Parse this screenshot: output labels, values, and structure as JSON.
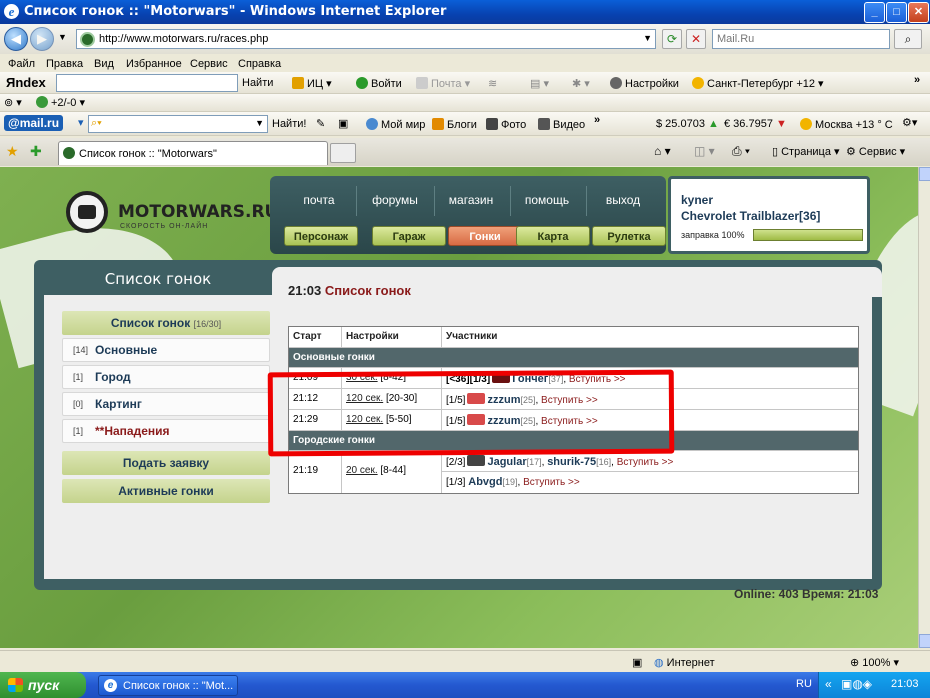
{
  "window": {
    "title": "Список гонок :: \"Motorwars\" - Windows Internet Explorer",
    "min": "_",
    "max": "□",
    "close": "✕"
  },
  "browser": {
    "address": "http://www.motorwars.ru/races.php",
    "search_placeholder": "Mail.Ru",
    "menu": [
      "Файл",
      "Правка",
      "Вид",
      "Избранное",
      "Сервис",
      "Справка"
    ],
    "yandex": {
      "brand": "Яndex",
      "find": "Найти",
      "ic": "ИЦ",
      "login": "Войти",
      "mail": "Почта",
      "settings": "Настройки",
      "weather": "Санкт-Петербург +12",
      "counter": "+2/-0"
    },
    "mailru": {
      "brand": "@mail.ru",
      "find": "Найти!",
      "myworld": "Мой мир",
      "blogs": "Блоги",
      "photo": "Фото",
      "video": "Видео",
      "usd": "$ 25.0703",
      "eur": "€ 36.7957",
      "weather": "Москва +13 ° С"
    },
    "tab": "Список гонок :: \"Motorwars\"",
    "tab_tools": {
      "page": "Страница",
      "service": "Сервис"
    },
    "status": {
      "zone": "Интернет",
      "zoom": "100%"
    }
  },
  "site": {
    "logo": {
      "name": "MOTORWARS.RU",
      "sub": "СКОРОСТЬ ОН-ЛАЙН"
    },
    "topnav": [
      "почта",
      "форумы",
      "магазин",
      "помощь",
      "выход"
    ],
    "subnav": [
      "Персонаж",
      "Гараж",
      "Гонки",
      "Карта",
      "Рулетка"
    ],
    "active_subnav": "Гонки",
    "user": {
      "name": "kyner",
      "car": "Chevrolet Trailblazer[36]",
      "fuel_label": "заправка 100%",
      "fuel_percent": 100
    },
    "left_title": "Список гонок",
    "left_menu": [
      {
        "label": "Список гонок",
        "suffix": "[16/30]"
      },
      {
        "count": "[14]",
        "label": "Основные"
      },
      {
        "count": "[1]",
        "label": "Город"
      },
      {
        "count": "[0]",
        "label": "Картинг"
      },
      {
        "count": "[1]",
        "label": "**Нападения"
      },
      {
        "label": "Подать заявку"
      },
      {
        "label": "Активные гонки"
      }
    ],
    "content_time": "21:03",
    "content_title": "Список гонок",
    "table": {
      "headers": [
        "Старт",
        "Настройки",
        "Участники"
      ],
      "sections": [
        "Основные гонки",
        "Городские гонки"
      ],
      "main_races": [
        {
          "start": "21:09",
          "interval": "30 сек.",
          "range": "[8-42]",
          "slots": "[<36][1/3]",
          "nick": "Гончег",
          "level": "[37]",
          "join": "Вступить >>"
        },
        {
          "start": "21:12",
          "interval": "120 сек.",
          "range": "[20-30]",
          "slots": "[1/5]",
          "nick": "zzzum",
          "level": "[25]",
          "join": "Вступить >>"
        },
        {
          "start": "21:29",
          "interval": "120 сек.",
          "range": "[5-50]",
          "slots": "[1/5]",
          "nick": "zzzum",
          "level": "[25]",
          "join": "Вступить >>"
        }
      ],
      "city_race": {
        "start": "21:19",
        "interval": "20 сек.",
        "range": "[8-44]",
        "line1": {
          "slots": "[2/3]",
          "nick1": "Jagular",
          "level1": "[17]",
          "nick2": "shurik-75",
          "level2": "[16]",
          "join": "Вступить >>"
        },
        "line2": {
          "slots": "[1/3]",
          "nick": "Abvgd",
          "level": "[19]",
          "join": "Вступить >>"
        }
      }
    },
    "online": "Online: 403  Время: 21:03"
  },
  "taskbar": {
    "start": "пуск",
    "item": "Список гонок :: \"Mot...",
    "lang": "RU",
    "time": "21:03"
  },
  "colors": {
    "accent_red": "#ee0000",
    "panel": "#3e5f63",
    "link_dark": "#1d3b57"
  }
}
